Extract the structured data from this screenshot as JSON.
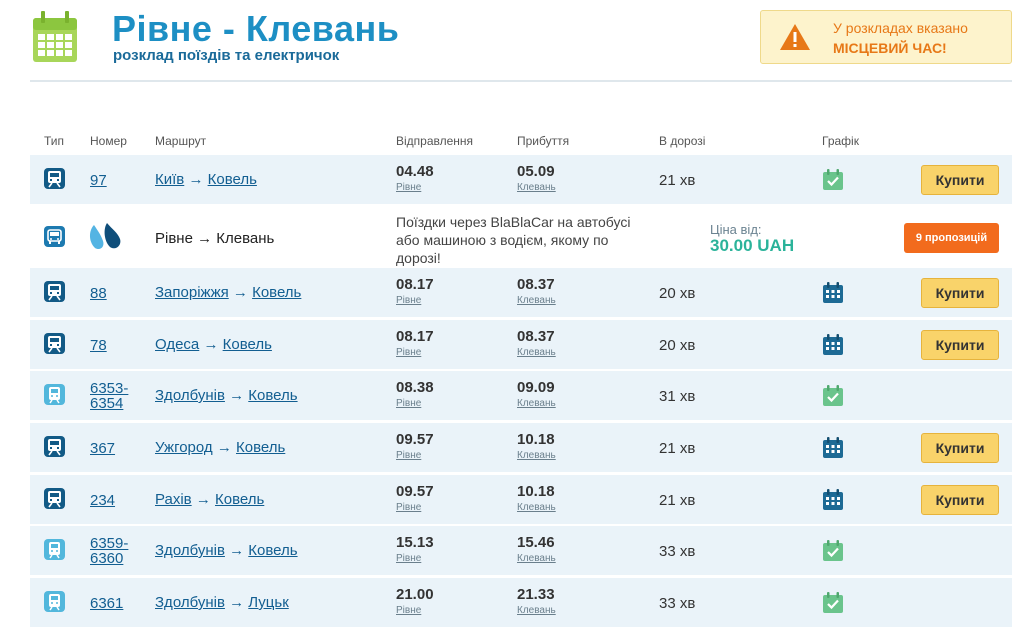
{
  "header": {
    "title": "Рівне - Клевань",
    "subtitle": "розклад поїздів та електричок",
    "notice_line1": "У розкладах вказано",
    "notice_line2": "МІСЦЕВИЙ ЧАС!"
  },
  "columns": {
    "type": "Тип",
    "number": "Номер",
    "route": "Маршрут",
    "departure": "Відправлення",
    "arrival": "Прибуття",
    "duration": "В дорозі",
    "schedule": "Графік"
  },
  "rows": [
    {
      "type": "train",
      "number": "97",
      "from": "Київ",
      "to": "Ковель",
      "dep": "04.48",
      "dep_station": "Рівне",
      "arr": "05.09",
      "arr_station": "Клевань",
      "duration": "21 хв",
      "schedule": "daily",
      "buy": "Купити"
    },
    {
      "type": "train",
      "number": "88",
      "from": "Запоріжжя",
      "to": "Ковель",
      "dep": "08.17",
      "dep_station": "Рівне",
      "arr": "08.37",
      "arr_station": "Клевань",
      "duration": "20 хв",
      "schedule": "calendar",
      "buy": "Купити"
    },
    {
      "type": "train",
      "number": "78",
      "from": "Одеса",
      "to": "Ковель",
      "dep": "08.17",
      "dep_station": "Рівне",
      "arr": "08.37",
      "arr_station": "Клевань",
      "duration": "20 хв",
      "schedule": "calendar",
      "buy": "Купити"
    },
    {
      "type": "elektrichka",
      "number": "6353-6354",
      "num_line1": "6353-",
      "num_line2": "6354",
      "from": "Здолбунів",
      "to": "Ковель",
      "dep": "08.38",
      "dep_station": "Рівне",
      "arr": "09.09",
      "arr_station": "Клевань",
      "duration": "31 хв",
      "schedule": "daily",
      "buy": ""
    },
    {
      "type": "train",
      "number": "367",
      "from": "Ужгород",
      "to": "Ковель",
      "dep": "09.57",
      "dep_station": "Рівне",
      "arr": "10.18",
      "arr_station": "Клевань",
      "duration": "21 хв",
      "schedule": "calendar",
      "buy": "Купити"
    },
    {
      "type": "train",
      "number": "234",
      "from": "Рахів",
      "to": "Ковель",
      "dep": "09.57",
      "dep_station": "Рівне",
      "arr": "10.18",
      "arr_station": "Клевань",
      "duration": "21 хв",
      "schedule": "calendar",
      "buy": "Купити"
    },
    {
      "type": "elektrichka",
      "number": "6359-6360",
      "num_line1": "6359-",
      "num_line2": "6360",
      "from": "Здолбунів",
      "to": "Ковель",
      "dep": "15.13",
      "dep_station": "Рівне",
      "arr": "15.46",
      "arr_station": "Клевань",
      "duration": "33 хв",
      "schedule": "daily",
      "buy": ""
    },
    {
      "type": "elektrichka",
      "number": "6361",
      "from": "Здолбунів",
      "to": "Луцьк",
      "dep": "21.00",
      "dep_station": "Рівне",
      "arr": "21.33",
      "arr_station": "Клевань",
      "duration": "33 хв",
      "schedule": "daily",
      "buy": ""
    }
  ],
  "blablacar": {
    "route_from": "Рівне",
    "route_to": "Клевань",
    "description": "Поїздки через BlaBlaCar на автобусі або машиною з водієм, якому по дорозі!",
    "price_label": "Ціна від:",
    "price_value": "30.00 UAH",
    "offers_label": "9 пропозицій"
  },
  "icons": {
    "logo": "calendar-icon",
    "notice": "warning-icon",
    "train": "train-icon",
    "elektrichka": "elektrichka-icon",
    "bus": "bus-icon",
    "blablacar": "blablacar-logo-icon",
    "schedule_daily": "calendar-check-icon",
    "schedule_calendar": "calendar-grid-icon"
  },
  "colors": {
    "title": "#1d8fc4",
    "link": "#125e91",
    "row_alt": "#eaf3f9",
    "buy": "#f9d36a",
    "offers": "#f26b1d",
    "price": "#2bb39a",
    "notice_text": "#e77817",
    "train_icon": "#125a86",
    "elektrichka_icon": "#52b7dc",
    "calendar_green": "#6ac48c",
    "calendar_blue": "#1d6a95"
  }
}
